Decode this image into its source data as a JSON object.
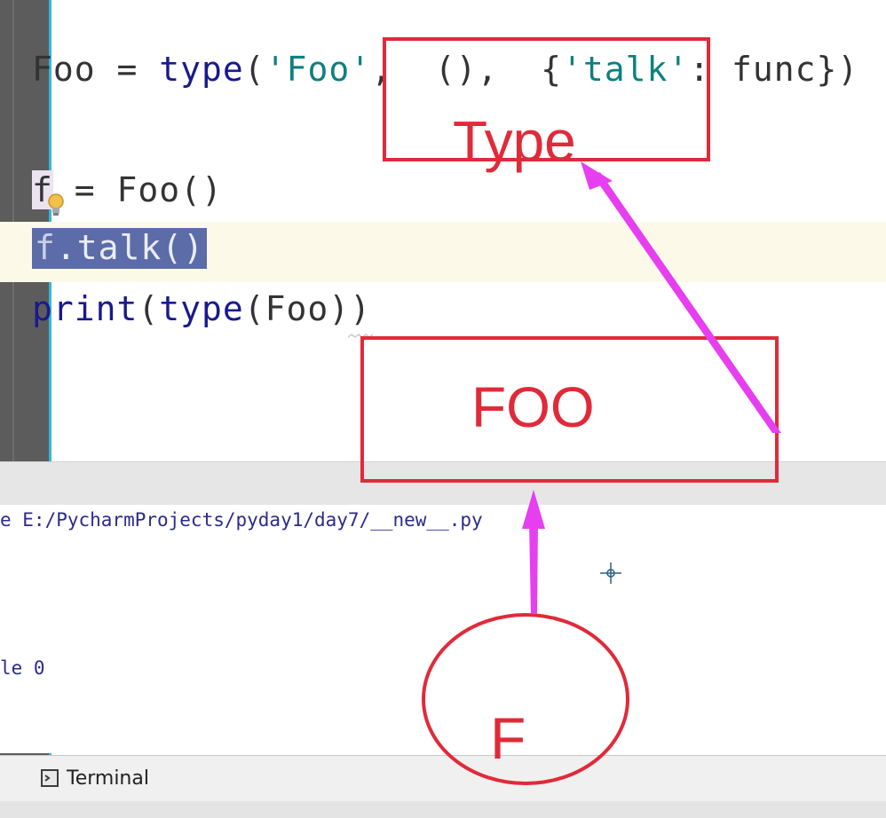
{
  "editor": {
    "lines": {
      "line1": {
        "lhs": "Foo",
        "op": " = ",
        "fn": "type",
        "p1": "(",
        "s1": "'Foo'",
        "mid": ",  (),  {",
        "s2": "'talk'",
        "tail": ": func})"
      },
      "line2": {
        "var": "f",
        "rest": " = Foo()"
      },
      "line3": {
        "sel_first": "f",
        "sel_rest": ".talk()"
      },
      "line4": {
        "kw": "print",
        "p1": "(",
        "fn": "type",
        "rest": "(Foo))"
      }
    }
  },
  "run": {
    "path": "e E:/PycharmProjects/pyday1/day7/__new__.py",
    "exit": "le 0"
  },
  "bottom": {
    "terminal_label": "Terminal"
  },
  "annotations": {
    "type_label": "Type",
    "foo_label": "FOO",
    "f_label": "F",
    "colors": {
      "box": "#e02a3a",
      "arrow": "#e63ff0"
    }
  }
}
